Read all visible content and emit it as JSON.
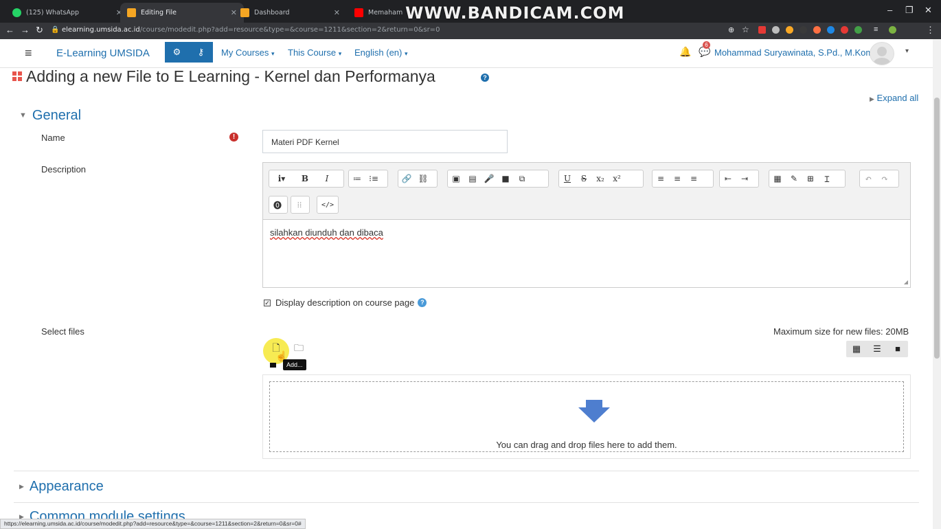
{
  "browser": {
    "tabs": [
      {
        "label": "(125) WhatsApp",
        "color": "#25d366"
      },
      {
        "label": "Editing File",
        "color": "#f5a623"
      },
      {
        "label": "Dashboard",
        "color": "#f5a623"
      },
      {
        "label": "Memahami Cara K...",
        "color": "#ff0000"
      }
    ],
    "watermark": "WWW.BANDICAM.COM",
    "url_host": "elearning.umsida.ac.id",
    "url_path": "/course/modedit.php?add=resource&type=&course=1211&section=2&return=0&sr=0",
    "status_url": "https://elearning.umsida.ac.id/course/modedit.php?add=resource&type=&course=1211&section=2&return=0&sr=0#"
  },
  "navbar": {
    "brand": "E-Learning UMSIDA",
    "links": [
      "My Courses",
      "This Course",
      "English (en)"
    ],
    "notification_count": "6",
    "user_name": "Mohammad Suryawinata, S.Pd., M.Kom"
  },
  "page": {
    "title": "Adding a new File to E Learning - Kernel dan Performanya",
    "expand_all": "Expand all"
  },
  "general": {
    "heading": "General",
    "name_label": "Name",
    "name_value": "Materi PDF Kernel",
    "description_label": "Description",
    "description_text": "silahkan diunduh dan dibaca",
    "display_description_label": "Display description on course page",
    "select_files_label": "Select files",
    "max_size": "Maximum size for new files: 20MB",
    "add_tooltip": "Add...",
    "drop_text": "You can drag and drop files here to add them."
  },
  "sections": {
    "appearance": "Appearance",
    "common": "Common module settings"
  },
  "toolbar_row1": [
    "i▾",
    "B",
    "I",
    "≔",
    "⁝≡",
    "🔗",
    "⛓",
    "▣",
    "▤",
    "🎤",
    "■",
    "⧉",
    "U",
    "S",
    "x₂",
    "x²",
    "≡",
    "≡",
    "≡",
    "⇤",
    "⇥",
    "▦",
    "✎",
    "⊞",
    "Ɪ",
    "↶",
    "↷"
  ],
  "toolbar_row2": [
    "⓿",
    "⁞⁞",
    "</>"
  ]
}
